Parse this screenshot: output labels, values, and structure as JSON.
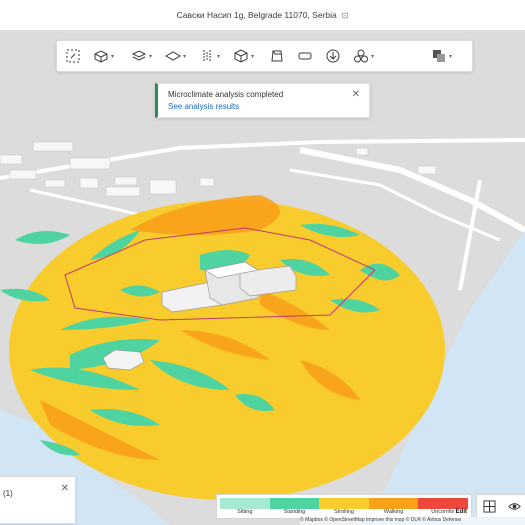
{
  "header": {
    "address": "Савски Насип 1g, Belgrade 11070, Serbia"
  },
  "toolbar": {
    "tools": [
      {
        "icon": "magic-select-icon",
        "dropdown": false
      },
      {
        "icon": "building-icon",
        "dropdown": true
      },
      {
        "icon": "layers-icon",
        "dropdown": true
      },
      {
        "icon": "plane-icon",
        "dropdown": true
      },
      {
        "icon": "split-icon",
        "dropdown": true
      },
      {
        "icon": "cube-icon",
        "dropdown": true
      },
      {
        "icon": "box-outline-icon",
        "dropdown": false
      },
      {
        "icon": "tag-icon",
        "dropdown": false
      },
      {
        "icon": "download-icon",
        "dropdown": false
      },
      {
        "icon": "cluster-icon",
        "dropdown": true
      },
      {
        "icon": "overlay-icon",
        "dropdown": true
      }
    ]
  },
  "toast": {
    "title": "Microclimate analysis completed",
    "link": "See analysis results"
  },
  "panel": {
    "count": "(1)"
  },
  "legend": {
    "items": [
      {
        "label": "Sitting",
        "color": "#a8ead1"
      },
      {
        "label": "Standing",
        "color": "#4fd3a1"
      },
      {
        "label": "Strolling",
        "color": "#f8cc2c"
      },
      {
        "label": "Walking",
        "color": "#f9a01b"
      },
      {
        "label": "Uncomfor",
        "color": "#f0473d"
      }
    ],
    "edit_label": "Edit"
  },
  "attribution": "© Mapbox © OpenStreetMap Improve this map © DLR © Airbus Defense",
  "colors": {
    "ground": "#dcdcdc",
    "water": "#d2e5f5",
    "strolling": "#f8cc2c",
    "walking": "#f9a01b",
    "standing": "#4fd3a1",
    "site_outline": "#c0396a"
  }
}
